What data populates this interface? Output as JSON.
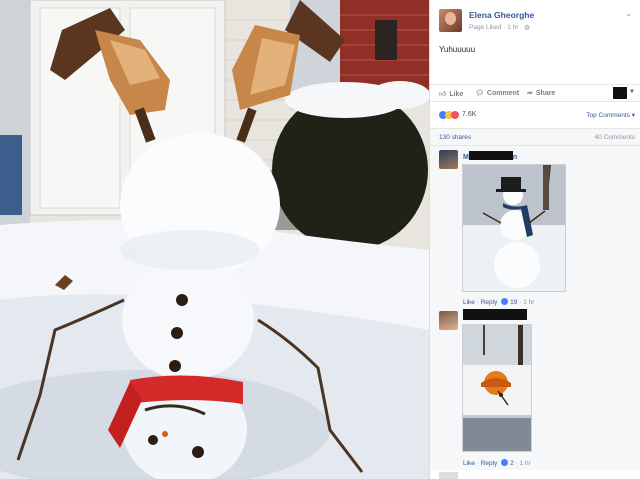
{
  "post": {
    "author": "Elena Gheorghe",
    "meta": "Page Liked · 1 hr · ",
    "text": "Yuhuuuuu",
    "actions": {
      "like": "Like",
      "comment": "Comment",
      "share": "Share"
    },
    "reactions_count": "7.6K",
    "top_comments_label": "Top Comments ▾",
    "shares": "130 shares",
    "comments_count": "40 Comments"
  },
  "comments": [
    {
      "name_visible": "M",
      "name_tail": "n",
      "actions": {
        "like": "Like",
        "reply": "Reply",
        "likes": "19",
        "time": "1 hr"
      }
    },
    {
      "name_visible": "",
      "name_tail": "",
      "actions": {
        "like": "Like",
        "reply": "Reply",
        "likes": "2",
        "time": "1 hr"
      }
    }
  ],
  "icons": {
    "like": "thumbs-up-icon",
    "comment": "comment-bubble-icon",
    "share": "share-arrow-icon",
    "globe": "globe-icon",
    "chevron": "chevron-down-icon"
  },
  "colors": {
    "link_blue": "#365899",
    "muted": "#90949c",
    "scarf_red": "#d42a2a",
    "like_blue": "#4080ff"
  }
}
